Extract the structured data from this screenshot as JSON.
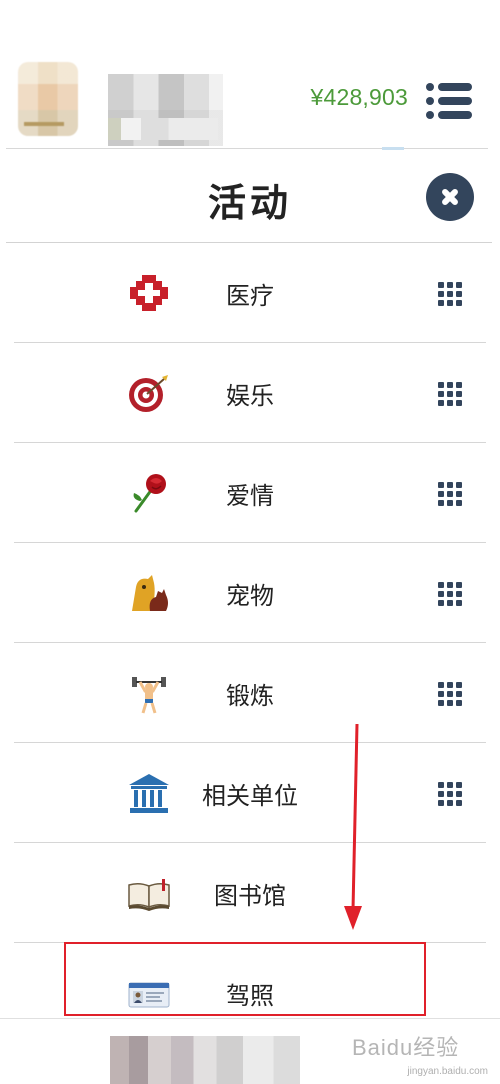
{
  "header": {
    "balance": "¥428,903",
    "menu_icon": "list-menu-icon"
  },
  "modal": {
    "title": "活动",
    "close_icon": "close-icon"
  },
  "items": [
    {
      "label": "医疗",
      "icon": "medical-cross-icon",
      "has_grid": true
    },
    {
      "label": "娱乐",
      "icon": "dart-target-icon",
      "has_grid": true
    },
    {
      "label": "爱情",
      "icon": "rose-icon",
      "has_grid": true
    },
    {
      "label": "宠物",
      "icon": "pets-icon",
      "has_grid": true
    },
    {
      "label": "锻炼",
      "icon": "weightlifter-icon",
      "has_grid": true
    },
    {
      "label": "相关单位",
      "icon": "bank-building-icon",
      "has_grid": true
    },
    {
      "label": "图书馆",
      "icon": "open-book-icon",
      "has_grid": false
    },
    {
      "label": "驾照",
      "icon": "id-card-icon",
      "has_grid": false
    }
  ],
  "watermark": {
    "text": "Baidu经验",
    "sub": "jingyan.baidu.com"
  },
  "colors": {
    "accent_dark": "#33455c",
    "balance_green": "#4c9a3a",
    "highlight_red": "#e0202a"
  }
}
